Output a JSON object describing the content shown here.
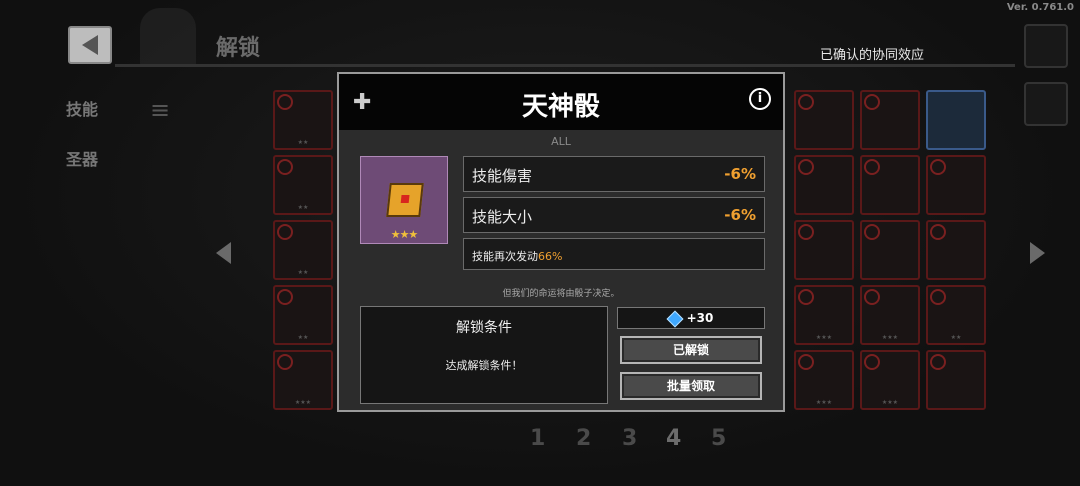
{
  "version": "Ver. 0.761.0",
  "header": {
    "title": "解锁",
    "synergy_label": "已确认的协同效应"
  },
  "sidebar": {
    "tabs": [
      {
        "label": "技能"
      },
      {
        "label": "圣器"
      }
    ]
  },
  "pager": {
    "pages": [
      "1",
      "2",
      "3",
      "4",
      "5"
    ],
    "current": "4"
  },
  "modal": {
    "title": "天神骰",
    "category": "ALL",
    "stars": "★★★",
    "stats": [
      {
        "label": "技能傷害",
        "value": "-6%"
      },
      {
        "label": "技能大小",
        "value": "-6%"
      }
    ],
    "extra_stat": {
      "label": "技能再次发动",
      "value": "66%"
    },
    "description": "但我们的命运将由骰子决定。",
    "unlock": {
      "title": "解锁条件",
      "text": "达成解锁条件！"
    },
    "reward": "+30",
    "buttons": {
      "unlocked": "已解锁",
      "bulk_claim": "批量领取"
    }
  },
  "colors": {
    "accent": "#f0a030",
    "item_bg": "#6e4b76",
    "locked_border": "#5a1818"
  },
  "grid": {
    "left_stars": [
      "★★",
      "★★",
      "★★",
      "★★",
      "★★★"
    ],
    "right_stars": [
      "★★★",
      "★★★",
      "★★",
      "★★★",
      "★★★"
    ]
  }
}
